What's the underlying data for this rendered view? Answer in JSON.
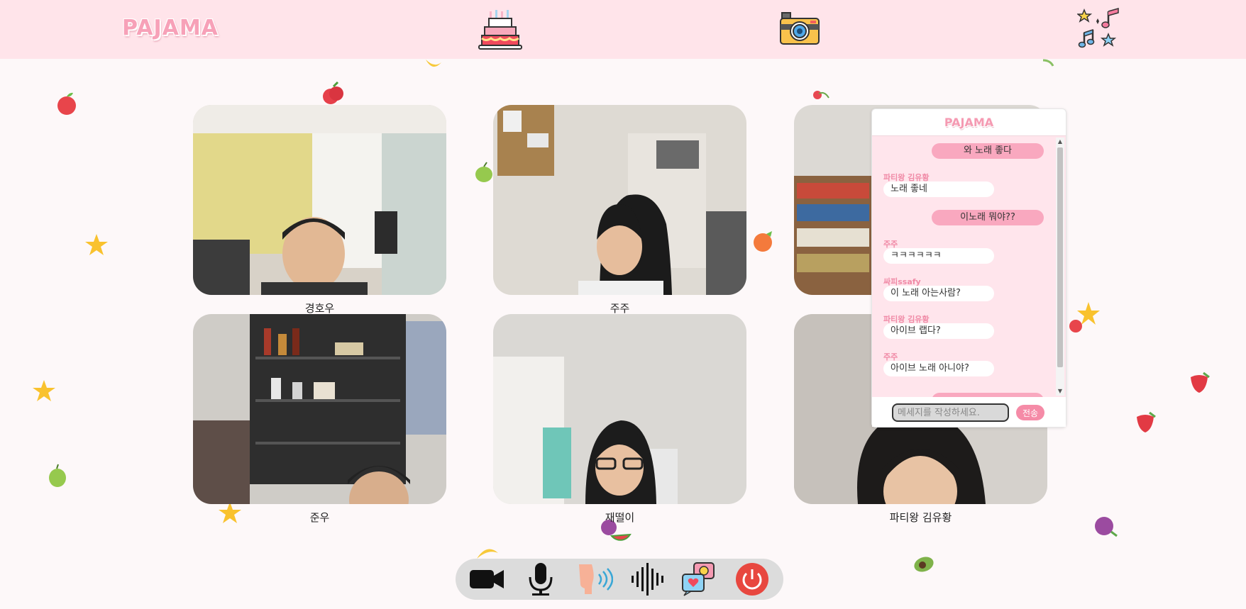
{
  "header": {
    "logo_text": "PAJAMA",
    "icons": [
      "birthday-cake-icon",
      "camera-icon",
      "music-stars-icon"
    ]
  },
  "participants": [
    {
      "name": "경호우"
    },
    {
      "name": "주주"
    },
    {
      "name": ""
    },
    {
      "name": "준우"
    },
    {
      "name": "재떨이"
    },
    {
      "name": "파티왕 김유황"
    }
  ],
  "chat": {
    "logo_text": "PAJAMA",
    "messages": [
      {
        "type": "mine",
        "text": "와 노래 좋다"
      },
      {
        "type": "other",
        "sender": "파티왕 김유황",
        "text": "노래 좋네"
      },
      {
        "type": "mine",
        "text": "이노래 뭐야??"
      },
      {
        "type": "other",
        "sender": "주주",
        "text": "ㅋㅋㅋㅋㅋㅋ"
      },
      {
        "type": "other",
        "sender": "싸피ssafy",
        "text": "이 노래 아는사람?"
      },
      {
        "type": "other",
        "sender": "파티왕 김유황",
        "text": "아이브 랩다?"
      },
      {
        "type": "other",
        "sender": "주주",
        "text": "아이브 노래 아니야?"
      }
    ],
    "input_placeholder": "메세지를 작성하세요.",
    "send_label": "전송"
  },
  "controls": [
    "video-camera-icon",
    "microphone-icon",
    "voice-filter-icon",
    "sound-wave-icon",
    "chat-bubbles-icon",
    "power-icon"
  ],
  "colors": {
    "header_bg": "#ffe4ea",
    "accent_pink": "#f58ba7",
    "chat_bg": "#ffe5ec",
    "power_red": "#e8473f"
  }
}
